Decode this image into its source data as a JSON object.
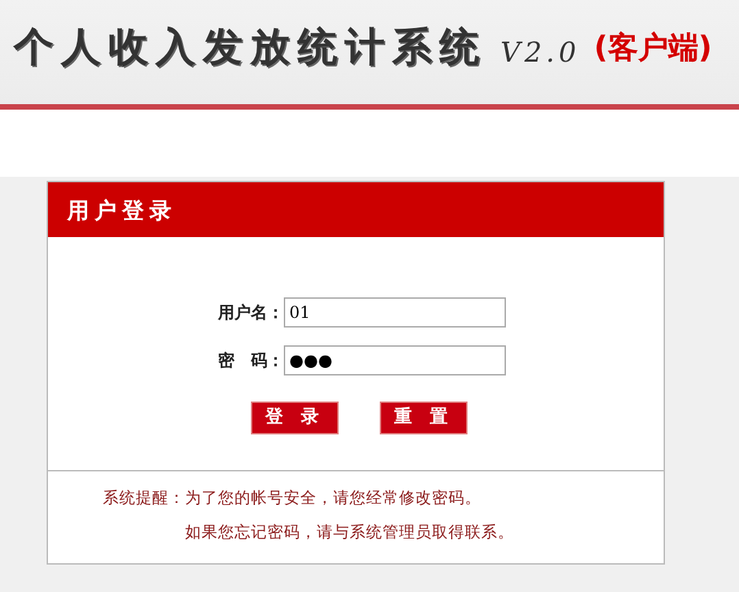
{
  "header": {
    "title": "个人收入发放统计系统",
    "version": "V2.0",
    "edition": "(客户端)"
  },
  "login": {
    "title": "用户登录",
    "fields": [
      {
        "label": "用户名：",
        "value": "01"
      },
      {
        "label": "密　码：",
        "value": "●●●"
      }
    ],
    "buttons": [
      "登 录",
      "重 置"
    ],
    "notice": [
      "系统提醒：为了您的帐号安全，请您经常修改密码。",
      "如果您忘记密码，请与系统管理员取得联系。"
    ]
  }
}
